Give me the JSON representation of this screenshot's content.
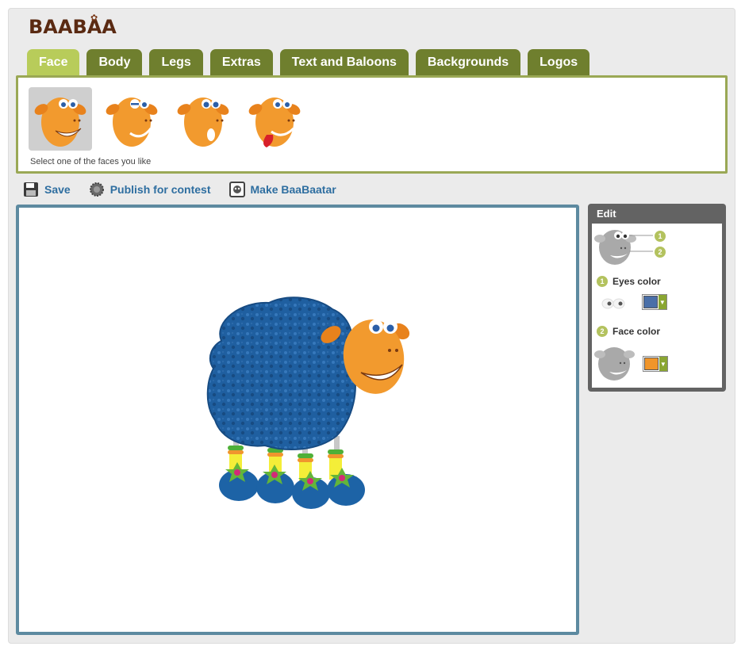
{
  "app": {
    "logo_text": "BAABAA"
  },
  "tabs": [
    {
      "label": "Face",
      "active": true
    },
    {
      "label": "Body",
      "active": false
    },
    {
      "label": "Legs",
      "active": false
    },
    {
      "label": "Extras",
      "active": false
    },
    {
      "label": "Text and Baloons",
      "active": false
    },
    {
      "label": "Backgrounds",
      "active": false
    },
    {
      "label": "Logos",
      "active": false
    }
  ],
  "face_panel": {
    "hint": "Select one of the faces you like",
    "faces": [
      {
        "icon": "grin-face-icon",
        "selected": true
      },
      {
        "icon": "wink-face-icon",
        "selected": false
      },
      {
        "icon": "surprised-face-icon",
        "selected": false
      },
      {
        "icon": "tongue-face-icon",
        "selected": false
      }
    ]
  },
  "toolbar": {
    "save_label": "Save",
    "publish_label": "Publish for contest",
    "make_label": "Make BaaBaatar"
  },
  "edit": {
    "title": "Edit",
    "badge_1": "1",
    "badge_2": "2",
    "eyes_label": "Eyes color",
    "face_label": "Face color",
    "eyes_color": "#4a6fa8",
    "face_color": "#f0952a"
  },
  "colors": {
    "tab_active": "#b8cc5a",
    "tab_inactive": "#6f7f2e",
    "panel_border": "#9aa855",
    "canvas_border": "#5d8aa0",
    "sheep_wool": "#1f5fa0",
    "sheep_face": "#f0952a"
  }
}
